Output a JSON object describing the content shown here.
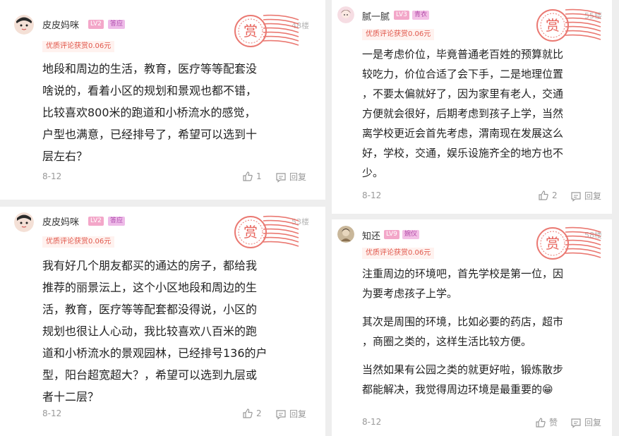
{
  "comments": [
    {
      "user": "皮皮妈咪",
      "level": "LV2",
      "tag": "答应",
      "floor": "48楼",
      "reward": "优质评论获赏0.06元",
      "stamp": "赏",
      "lines": [
        "地段和周边的生活，教育，医疗等等配套没",
        "啥说的，看着小区的规划和景观也都不错，",
        "比较喜欢800米的跑道和小桥流水的感觉，",
        "户型也满意，已经排号了，希望可以选到十",
        "层左右？"
      ],
      "date": "8-12",
      "likes": "1",
      "reply": "回复"
    },
    {
      "user": "皮皮妈咪",
      "level": "LV2",
      "tag": "答应",
      "floor": "53楼",
      "reward": "优质评论获赏0.06元",
      "stamp": "赏",
      "lines": [
        "我有好几个朋友都买的通达的房子，都给我",
        "推荐的丽景沄上，这个小区地段和周边的生",
        "活，教育，医疗等等配套都没得说，小区的",
        "规划也很让人心动，我比较喜欢八百米的跑",
        "道和小桥流水的景观园林，已经排号136的户",
        "型，阳台超宽超大？，希望可以选到九层或",
        "者十二层？"
      ],
      "date": "8-12",
      "likes": "2",
      "reply": "回复"
    },
    {
      "user": "腻一腻",
      "level": "LV3",
      "tag": "青衣",
      "floor": "55楼",
      "reward": "优质评论获赏0.06元",
      "stamp": "赏",
      "lines": [
        "一是考虑价位，毕竟普通老百姓的预算就比",
        "较吃力，价位合适了会下手，二是地理位置",
        "，不要太偏就好了，因为家里有老人，交通",
        "方便就会很好，后期考虑到孩子上学，当然",
        "离学校更近会首先考虑，渭南现在发展这么",
        "好，学校，交通，娱乐设施齐全的地方也不",
        "少。"
      ],
      "date": "8-12",
      "likes": "2",
      "reply": "回复"
    },
    {
      "user": "知还",
      "level": "LV9",
      "tag": "婉仪",
      "floor": "58楼",
      "reward": "优质评论获赏0.06元",
      "stamp": "赏",
      "paragraphs": [
        [
          "注重周边的环境吧，首先学校是第一位，因",
          "为要考虑孩子上学。"
        ],
        [
          "其次是周围的环境，比如必要的药店，超市",
          "，商圈之类的，这样生活比较方便。"
        ],
        [
          "当然如果有公园之类的就更好啦，锻炼散步",
          "都能解决，我觉得周边环境是最重要的😁"
        ]
      ],
      "date": "8-12",
      "likes": "赞",
      "reply": "回复"
    }
  ],
  "colors": {
    "stamp_red": "#e7625a",
    "reward_red": "#e0574b",
    "level_pink": "#f3a7c9"
  }
}
